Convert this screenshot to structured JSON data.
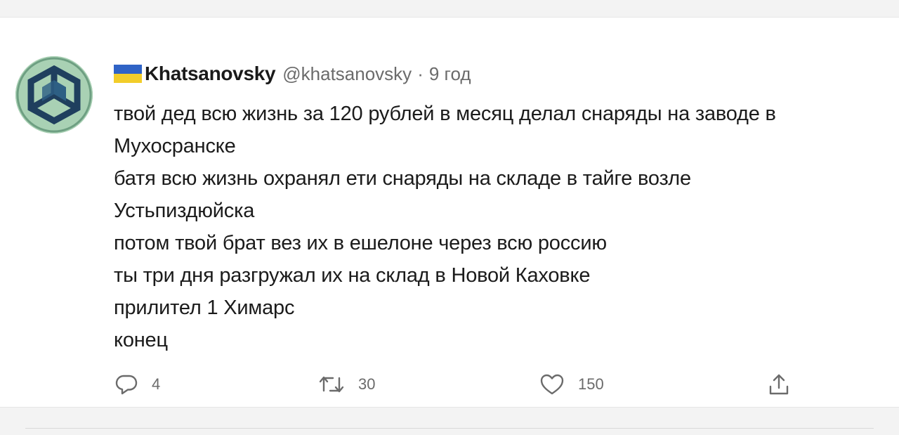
{
  "tweet": {
    "author": {
      "name": "Khatsanovsky",
      "handle": "@khatsanovsky",
      "separator": "·",
      "time": "9 год"
    },
    "lines": [
      "твой дед всю жизнь за 120 рублей в месяц делал снаряды на заводе в",
      "Мухосранске",
      "батя всю жизнь охранял ети снаряды на складе в тайге возле",
      "Устьпиздюйска",
      "потом твой брат вез их в ешелоне через всю россию",
      "ты три дня разгружал их на склад в Новой Каховке",
      "прилител 1 Химарс",
      "конец"
    ],
    "actions": {
      "reply_count": "4",
      "retweet_count": "30",
      "like_count": "150"
    },
    "icons": {
      "reply": "reply-icon",
      "retweet": "retweet-icon",
      "like": "heart-icon",
      "share": "share-icon",
      "flag": "ukraine-flag-icon",
      "avatar": "cube-logo-avatar"
    },
    "colors": {
      "flag_blue": "#2f63c6",
      "flag_yellow": "#f2cd2a",
      "text": "#1b1b1b",
      "muted": "#6b6b6b"
    }
  }
}
